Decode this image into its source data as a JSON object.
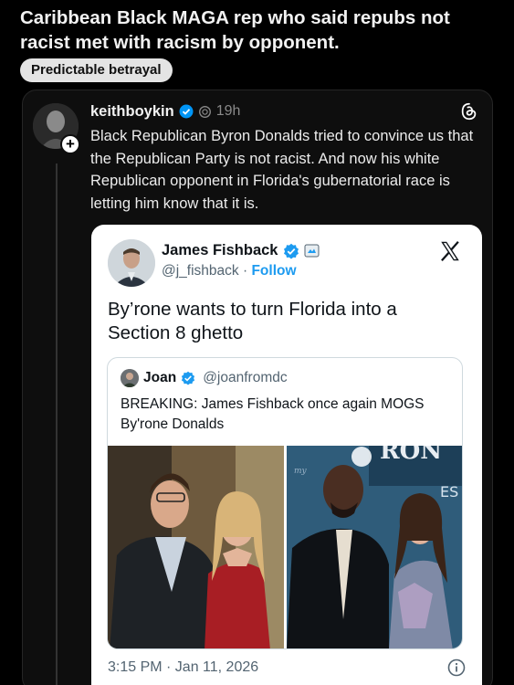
{
  "post": {
    "title": "Caribbean Black MAGA rep who said repubs not racist met with racism by opponent.",
    "flair": "Predictable betrayal"
  },
  "threads": {
    "username": "keithboykin",
    "time": "19h",
    "body": "Black Republican Byron Donalds tried to convince us that the Republican Party is not racist. And now his white Republican opponent in Florida's gubernatorial race is letting him know that it is.",
    "plus": "+"
  },
  "tweet": {
    "name": "James Fishback",
    "handle": "@j_fishback",
    "separator": " · ",
    "follow": "Follow",
    "text": "By’rone wants to turn Florida into a Section 8 ghetto",
    "timestamp": "3:15 PM · Jan 11, 2026",
    "quote": {
      "name": "Joan",
      "handle": "@joanfromdc",
      "text": "BREAKING: James Fishback once again MOGS By'rone Donalds"
    }
  },
  "colors": {
    "x_blue": "#1d9bf0",
    "verified": "#1d9bf0",
    "threads_verified": "#0095f6"
  }
}
